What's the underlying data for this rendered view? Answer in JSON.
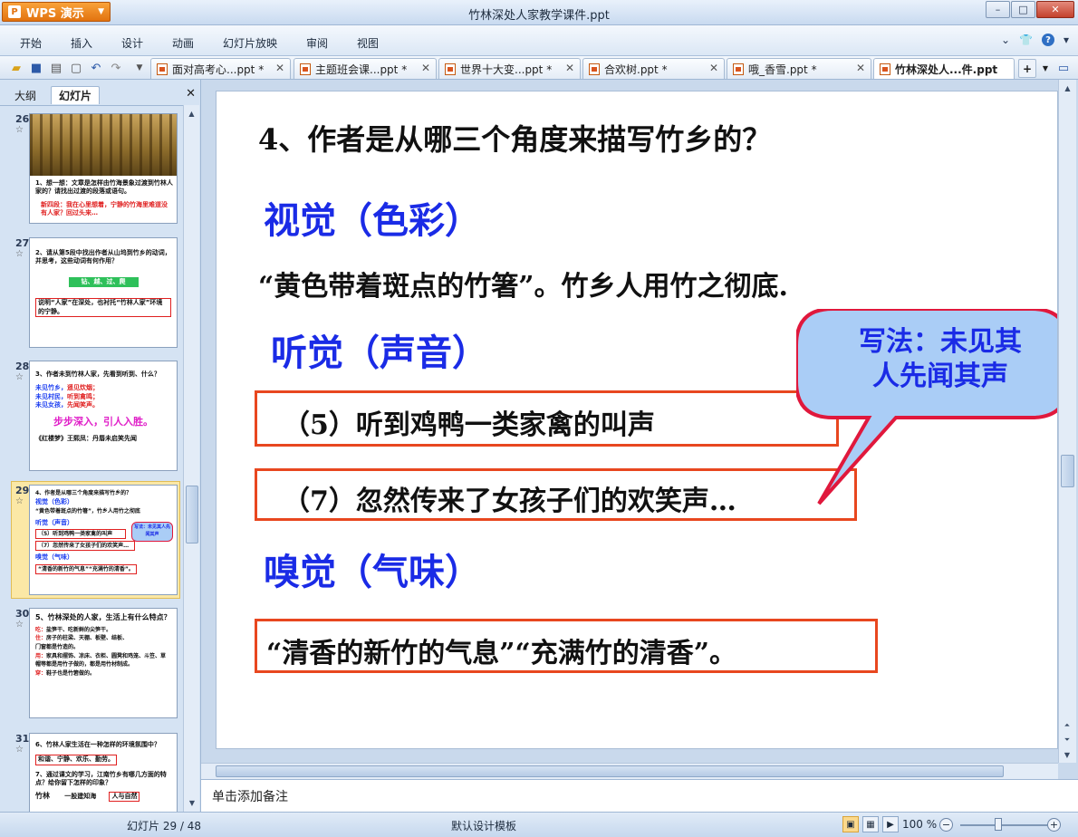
{
  "window": {
    "app_button": "WPS 演示",
    "title": "竹林深处人家教学课件.ppt",
    "controls": [
      "–",
      "□",
      "✕"
    ]
  },
  "menu": {
    "items": [
      "开始",
      "插入",
      "设计",
      "动画",
      "幻灯片放映",
      "审阅",
      "视图"
    ]
  },
  "tabs": [
    {
      "label": "面对高考心...ppt *",
      "active": false
    },
    {
      "label": "主题班会课...ppt *",
      "active": false
    },
    {
      "label": "世界十大变...ppt *",
      "active": false
    },
    {
      "label": "合欢树.ppt *",
      "active": false
    },
    {
      "label": "哦_香雪.ppt *",
      "active": false
    },
    {
      "label": "竹林深处人...件.ppt",
      "active": true
    }
  ],
  "panel": {
    "tabs": [
      "大纲",
      "幻灯片"
    ],
    "close": "✕"
  },
  "thumbnails": [
    {
      "num": "26",
      "lines": [
        "1、想一想：文章是怎样由竹海景象过渡到竹林人家的？请找出过渡的段落或语句。",
        "新四段：我在心里想着，宁静的竹海里难道没有人家？回过头来…"
      ]
    },
    {
      "num": "27",
      "lines": [
        "2、请从第5段中找出作者从山坞到竹乡的动词，并思考，这些动词有何作用？",
        "钻、越、过、爬",
        "说明“人家”在深处，也衬托“竹林人家”环境的宁静。"
      ]
    },
    {
      "num": "28",
      "lines": [
        "3、作者未到竹林人家，先看到听到、什么？",
        "未见竹乡，",
        "遥见炊烟；",
        "未见村民，",
        "听到禽鸣；",
        "未见女孩，",
        "先闻笑声。",
        "步步深入，引人入胜。",
        "《红楼梦》王熙凤：丹唇未启笑先闻"
      ]
    },
    {
      "num": "29",
      "lines": [
        "4、作者是从哪三个角度来描写竹乡的？",
        "视觉（色彩）",
        "“黄色带着斑点的竹箸”，竹乡人用竹之彻底",
        "听觉（声音）",
        "（5）听到鸡鸭一类家禽的叫声",
        "（7）忽然传来了女孩子们的欢笑声…",
        "嗅觉（气味）",
        "“清香的新竹的气息”“充满竹的清香”。",
        "写法：未见其人先闻其声"
      ]
    },
    {
      "num": "30",
      "lines": [
        "5、竹林深处的人家，生活上有什么特点？",
        "吃：",
        "盐笋干、吃新鲜的尖笋干。",
        "住：",
        "房子的柱梁、天棚、板壁、结板、",
        "门窗都是竹造的。",
        "用：",
        "家具和摆饰、凉床、衣柜、圆凳和鸡笼、斗笠、草帽等都是用竹子做的，都是用竹材制成。",
        "穿：",
        "鞋子也是竹箬做的。"
      ]
    },
    {
      "num": "31",
      "lines": [
        "6、竹林人家生活在一种怎样的环境氛围中？",
        "和谐、宁静、欢乐、勤劳。",
        "7、通过课文的学习，江南竹乡有哪几方面的特点？给你留下怎样的印象？",
        "竹林",
        "一股建知海",
        "人与自然"
      ]
    }
  ],
  "slide": {
    "question": "4、作者是从哪三个角度来描写竹乡的？",
    "visual_heading": "视觉（色彩）",
    "visual_text": "“黄色带着斑点的竹箸”。竹乡人用竹之彻底.",
    "audio_heading": "听觉（声音）",
    "audio_box1": "（5）听到鸡鸭一类家禽的叫声",
    "audio_box2": "（7）忽然传来了女孩子们的欢笑声…",
    "smell_heading": "嗅觉（气味）",
    "smell_box": "“清香的新竹的气息”“充满竹的清香”。",
    "callout_line1": "写法：未见其",
    "callout_line2": "人先闻其声"
  },
  "notes_placeholder": "单击添加备注",
  "status": {
    "slide_counter": "幻灯片 29 / 48",
    "template": "默认设计模板",
    "zoom": "100 %"
  },
  "colors": {
    "heading_blue": "#1a2be6",
    "box_red": "#e8471f",
    "callout_fill": "#aacdf6",
    "callout_border": "#e0183c"
  }
}
